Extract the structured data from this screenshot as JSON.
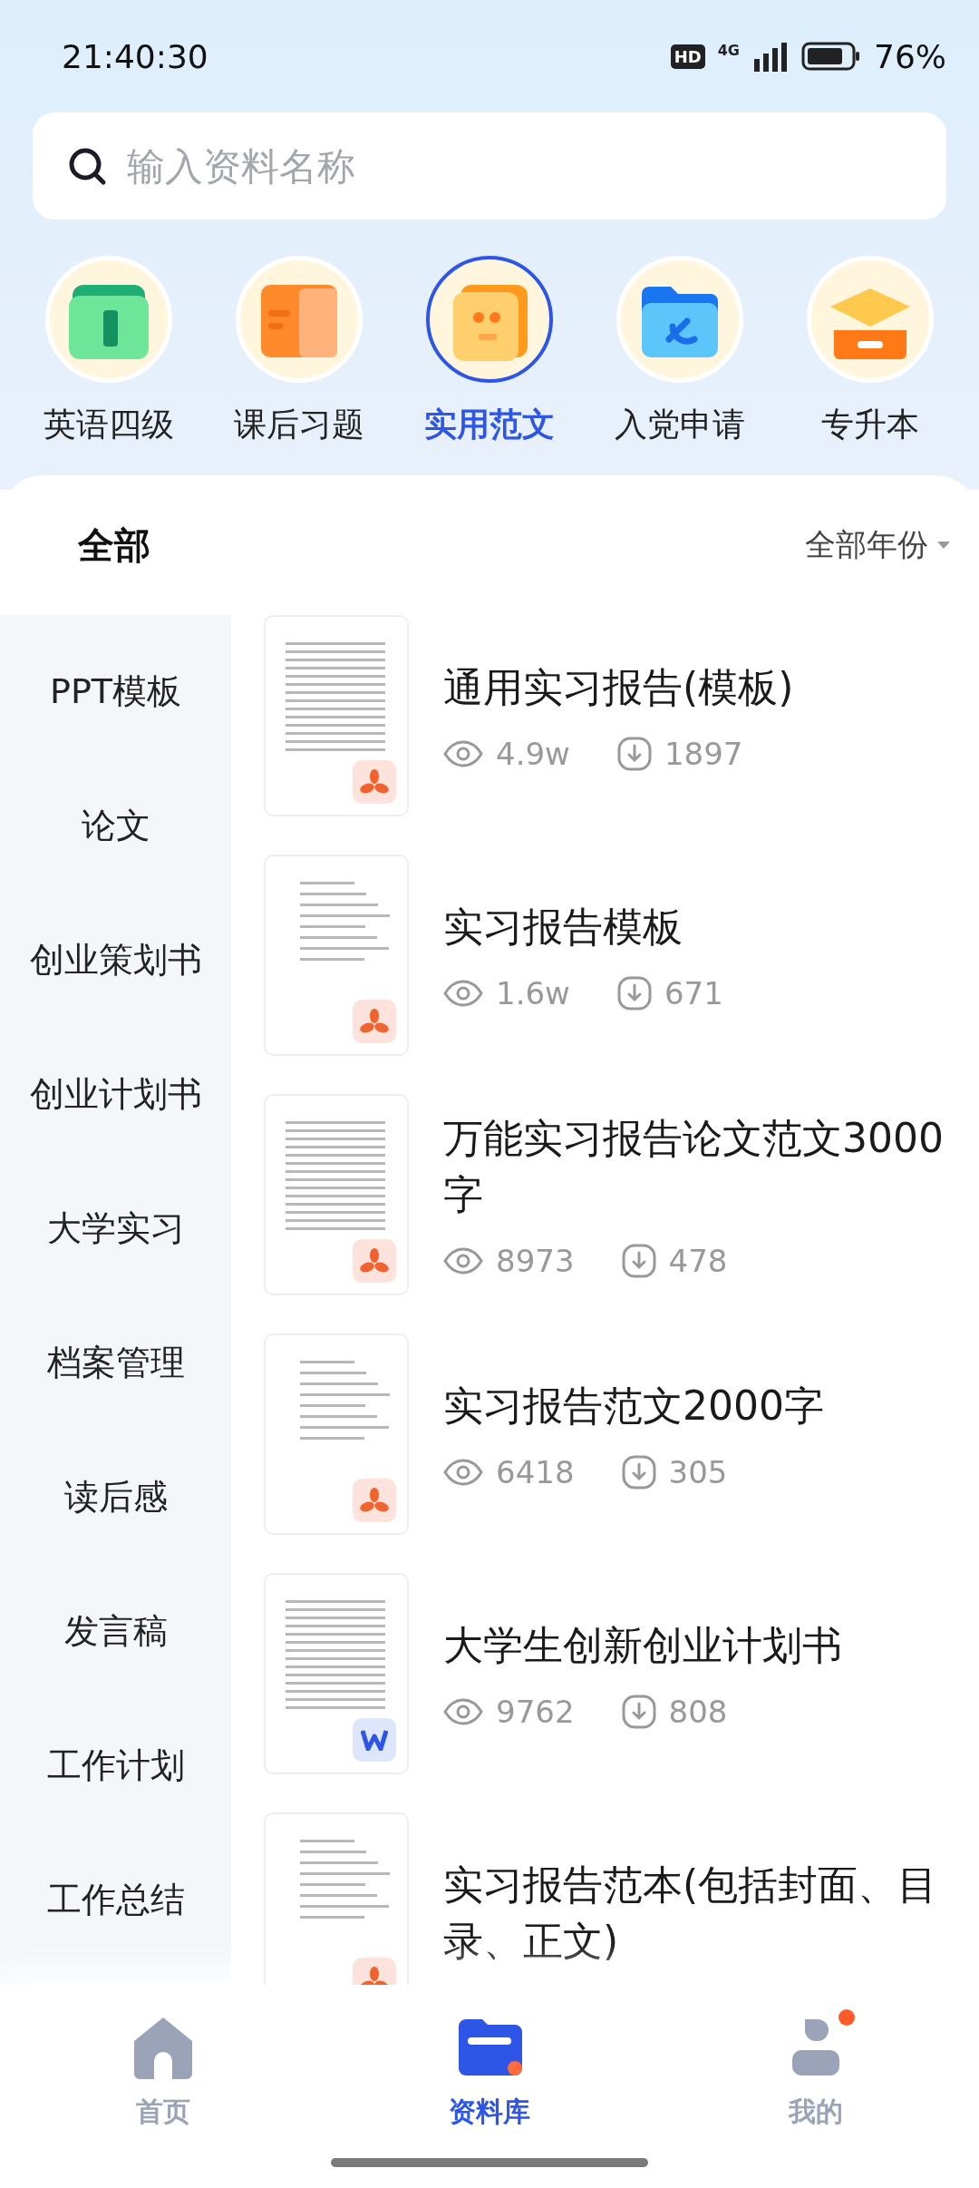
{
  "status_bar": {
    "time": "21:40:30",
    "hd": "HD",
    "network": "4G",
    "battery_text": "76%"
  },
  "search": {
    "placeholder": "输入资料名称"
  },
  "categories": [
    {
      "label": "英语四级",
      "kind": "book",
      "selected": false
    },
    {
      "label": "课后习题",
      "kind": "notebook",
      "selected": false
    },
    {
      "label": "实用范文",
      "kind": "quote",
      "selected": true
    },
    {
      "label": "入党申请",
      "kind": "folder",
      "selected": false
    },
    {
      "label": "专升本",
      "kind": "cap",
      "selected": false
    }
  ],
  "filter": {
    "tab": "全部",
    "year": "全部年份"
  },
  "sidebar": {
    "items": [
      "PPT模板",
      "论文",
      "创业策划书",
      "创业计划书",
      "大学实习",
      "档案管理",
      "读后感",
      "发言稿",
      "工作计划",
      "工作总结"
    ]
  },
  "documents": [
    {
      "title": "通用实习报告(模板)",
      "views": "4.9w",
      "downloads": "1897",
      "kind": "pdf"
    },
    {
      "title": "实习报告模板",
      "views": "1.6w",
      "downloads": "671",
      "kind": "pdf"
    },
    {
      "title": "万能实习报告论文范文3000字",
      "views": "8973",
      "downloads": "478",
      "kind": "pdf"
    },
    {
      "title": "实习报告范文2000字",
      "views": "6418",
      "downloads": "305",
      "kind": "pdf"
    },
    {
      "title": "大学生创新创业计划书",
      "views": "9762",
      "downloads": "808",
      "kind": "word"
    },
    {
      "title": "实习报告范本(包括封面、目录、正文)",
      "kind": "pdf"
    }
  ],
  "bottom_nav": [
    {
      "label": "首页",
      "kind": "home",
      "selected": false,
      "dot": false
    },
    {
      "label": "资料库",
      "kind": "library",
      "selected": true,
      "dot": false
    },
    {
      "label": "我的",
      "kind": "profile",
      "selected": false,
      "dot": true
    }
  ]
}
